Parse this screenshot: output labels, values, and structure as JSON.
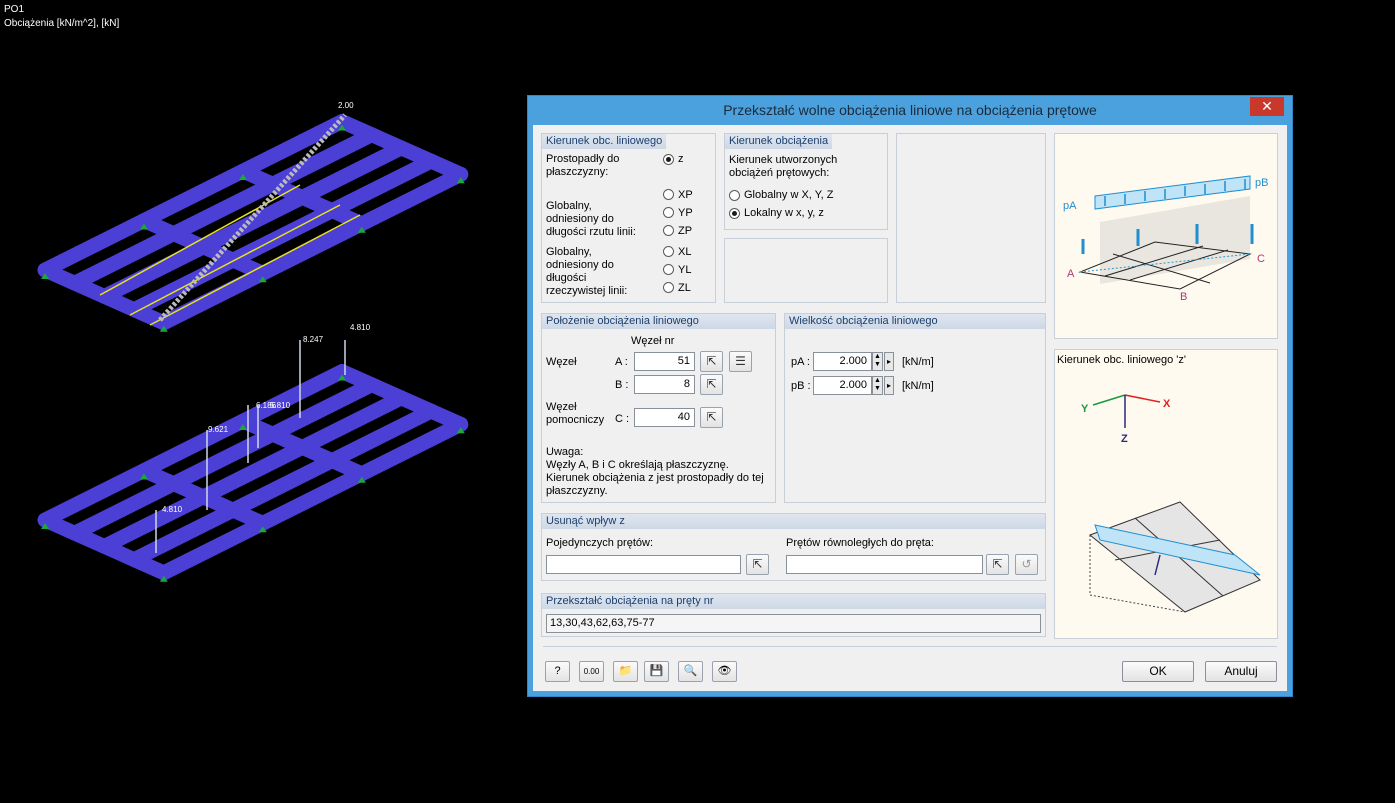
{
  "viewport": {
    "loadcase": "PO1",
    "units_line": "Obciążenia [kN/m^2], [kN]",
    "load_labels": [
      "2.00",
      "4.810",
      "8.247",
      "6.186",
      "5.810",
      "9.621",
      "4.810"
    ]
  },
  "dialog": {
    "title": "Przekształć wolne obciążenia liniowe na obciążenia prętowe",
    "close_label": "✕",
    "dir_line": {
      "header": "Kierunek obc. liniowego",
      "perp_label": "Prostopadły do płaszczyzny:",
      "z_label": "z",
      "glob_proj_label": "Globalny, odniesiony do długości rzutu linii:",
      "xp": "XP",
      "yp": "YP",
      "zp": "ZP",
      "glob_true_label": "Globalny, odniesiony do długości rzeczywistej linii:",
      "xl": "XL",
      "yl": "YL",
      "zl": "ZL"
    },
    "load_dir": {
      "header": "Kierunek obciążenia",
      "desc": "Kierunek utworzonych obciążeń prętowych:",
      "global": "Globalny w X, Y, Z",
      "local": "Lokalny w x, y, z"
    },
    "position": {
      "header": "Położenie obciążenia liniowego",
      "node_nr": "Węzeł nr",
      "node": "Węzeł",
      "a": "A :",
      "a_value": "51",
      "b": "B :",
      "b_value": "8",
      "aux": "Węzeł pomocniczy",
      "c": "C :",
      "c_value": "40",
      "note_title": "Uwaga:",
      "note": "Węzły A, B i C określają płaszczyznę. Kierunek obciążenia z jest prostopadły do tej płaszczyzny."
    },
    "magnitude": {
      "header": "Wielkość obciążenia liniowego",
      "pa": "pA :",
      "pa_value": "2.000",
      "pa_unit": "[kN/m]",
      "pb": "pB :",
      "pb_value": "2.000",
      "pb_unit": "[kN/m]"
    },
    "remove": {
      "header": "Usunąć wpływ z",
      "single": "Pojedynczych prętów:",
      "parallel": "Prętów równoległych do pręta:"
    },
    "convert": {
      "header": "Przekształć obciążenia na pręty nr",
      "value": "13,30,43,62,63,75-77"
    },
    "preview_bottom_title": "Kierunek obc. liniowego 'z'",
    "ok": "OK",
    "cancel": "Anuluj"
  }
}
